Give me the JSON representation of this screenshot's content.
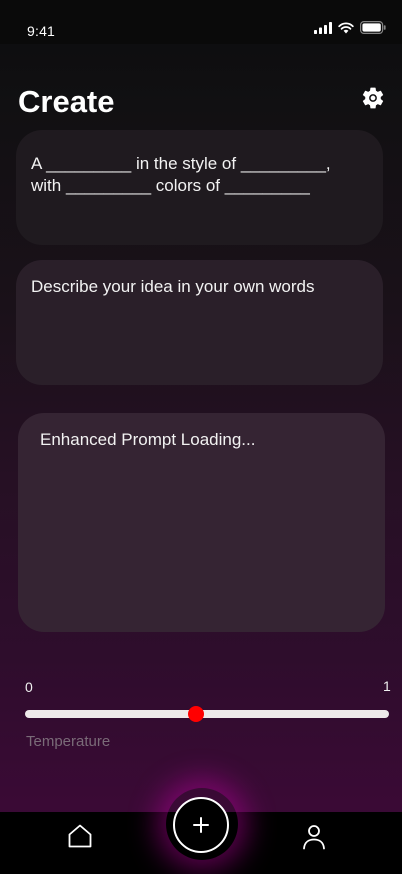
{
  "status_bar": {
    "time": "9:41",
    "icons": [
      "signal-icon",
      "wifi-icon",
      "battery-icon"
    ]
  },
  "header": {
    "title": "Create",
    "settings_icon": "gear-icon"
  },
  "prompt_template": {
    "text": "A _________ in the style of _________, with _________ colors of _________"
  },
  "idea_input": {
    "placeholder": "Describe your idea in your own words"
  },
  "enhanced_prompt": {
    "text": "Enhanced Prompt Loading..."
  },
  "temperature_slider": {
    "min_label": "0",
    "max_label": "1",
    "value": 0.47,
    "label": "Temperature",
    "track_color": "#eeeaea",
    "thumb_color": "#ff0000"
  },
  "bottom_nav": {
    "items": [
      {
        "name": "home",
        "icon": "home-icon"
      },
      {
        "name": "create",
        "icon": "plus-icon"
      },
      {
        "name": "profile",
        "icon": "user-icon"
      }
    ],
    "accent_glow": "#c800aa"
  }
}
